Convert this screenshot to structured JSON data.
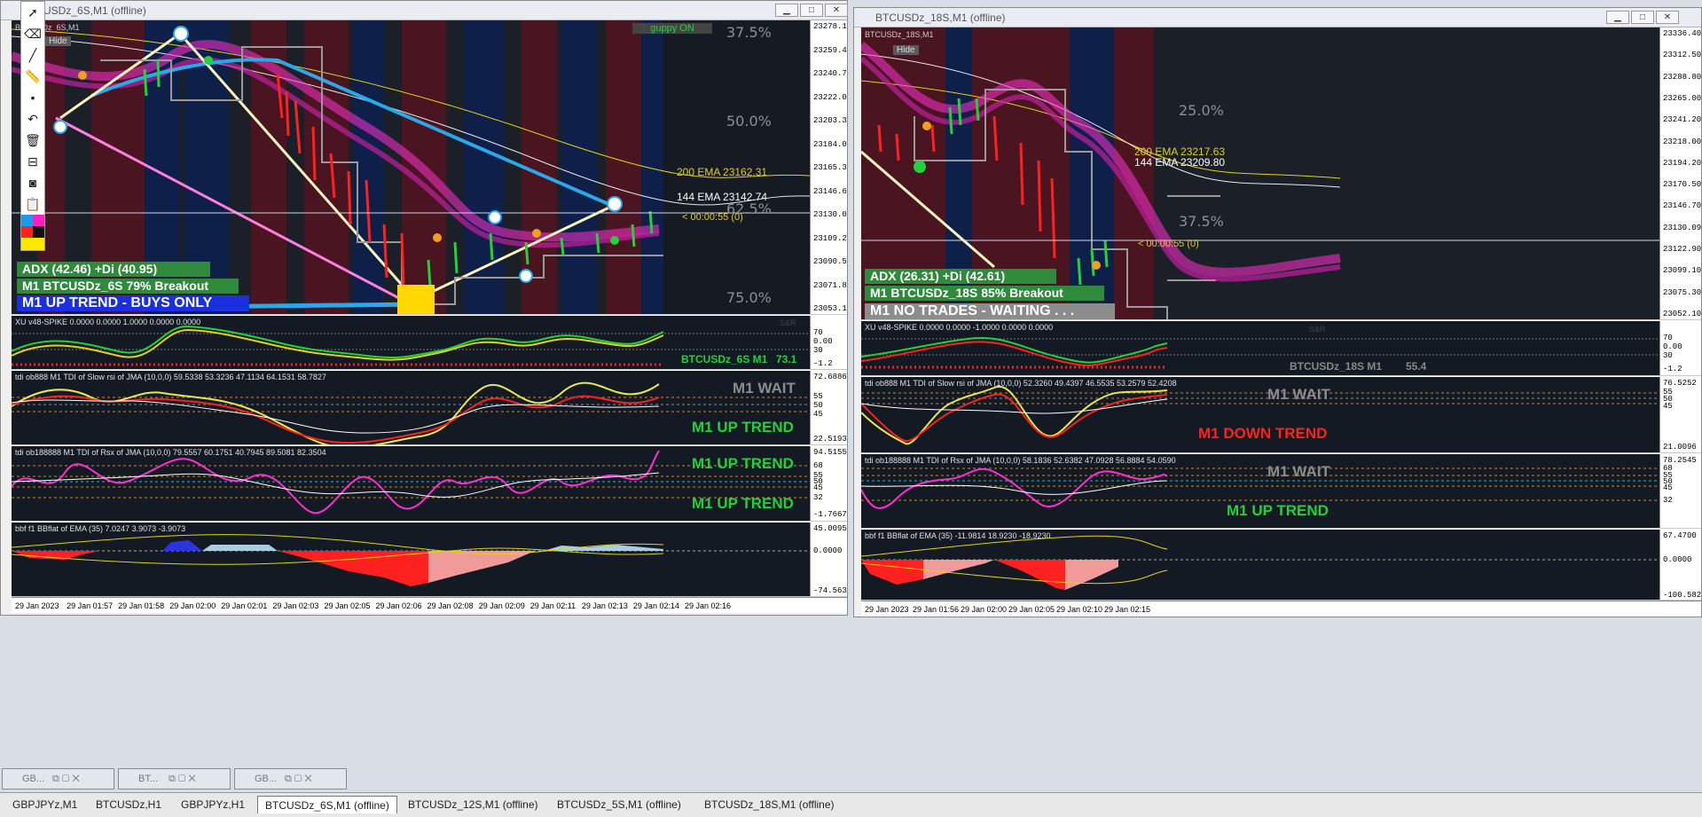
{
  "left_window": {
    "title": "BTCUSDz_6S,M1 (offline)",
    "chart_label": "BTCUSDz_6S,M1",
    "hide_button": "Hide",
    "guppy_button": "guppy ON",
    "price_axis": [
      "23278.10",
      "23259.40",
      "23240.70",
      "23222.00",
      "23203.30",
      "23184.05",
      "23165.35",
      "23146.65",
      "23130.09",
      "23109.25",
      "23090.55",
      "23071.85",
      "23053.15"
    ],
    "fib": [
      "37.5%",
      "50.0%",
      "62.5%",
      "75.0%"
    ],
    "ema200": "200 EMA 23162.31",
    "ema144": "144 EMA 23142.74",
    "countdown": "< 00:00:55 (0)",
    "adx": "ADX (42.46)  +Di (40.95)",
    "breakout": "M1 BTCUSDz_6S 79% Breakout",
    "trend_banner": "M1 UP TREND - BUYS ONLY",
    "spike_title": "XU v48-SPIKE 0.0000 0.0000 1.0000 0.0000 0.0000",
    "spike_axis": [
      "70",
      "0.00",
      "30",
      "-1.2"
    ],
    "spike_label": "BTCUSDz_6S M1",
    "spike_value": "73.1",
    "sr_label": "S&R",
    "tdi1_title": "tdi ob888 M1 TDI of Slow rsi of JMA (10,0,0) 59.5338 53.3236 47.1134 64.1531 58.7827",
    "tdi1_axis": [
      "72.6886",
      "55",
      "50",
      "45",
      "22.5193"
    ],
    "tdi1_status": "M1 WAIT",
    "tdi1_trend": "M1 UP TREND",
    "tdi2_title": "tdi ob188888 M1 TDI of Rsx of JMA (10,0,0) 79.5557 60.1751 40.7945 89.5081 82.3504",
    "tdi2_axis": [
      "94.5155",
      "68",
      "55",
      "50",
      "45",
      "32",
      "-1.7667"
    ],
    "tdi2_trend_top": "M1 UP TREND",
    "tdi2_trend_bottom": "M1 UP TREND",
    "bbf_title": "bbf f1 BBflat of EMA (35) 7.0247 3.9073 -3.9073",
    "bbf_axis": [
      "45.0095",
      "0.0000",
      "-74.5633"
    ],
    "time_axis": [
      "29 Jan 2023",
      "29 Jan 01:57",
      "29 Jan 01:58",
      "29 Jan 02:00",
      "29 Jan 02:01",
      "29 Jan 02:03",
      "29 Jan 02:05",
      "29 Jan 02:06",
      "29 Jan 02:08",
      "29 Jan 02:09",
      "29 Jan 02:11",
      "29 Jan 02:13",
      "29 Jan 02:14",
      "29 Jan 02:16"
    ]
  },
  "right_window": {
    "title": "BTCUSDz_18S,M1 (offline)",
    "chart_label": "BTCUSDz_18S,M1",
    "hide_button": "Hide",
    "price_axis": [
      "23336.40",
      "23312.50",
      "23288.80",
      "23265.00",
      "23241.20",
      "23218.00",
      "23194.20",
      "23170.50",
      "23146.70",
      "23130.09",
      "23122.90",
      "23099.10",
      "23075.30",
      "23052.10"
    ],
    "fib": [
      "25.0%",
      "37.5%"
    ],
    "ema200": "200 EMA 23217.63",
    "ema144": "144 EMA 23209.80",
    "countdown": "< 00:00:55 (0)",
    "adx": "ADX (26.31)  +Di (42.61)",
    "breakout": "M1 BTCUSDz_18S 85% Breakout",
    "trend_banner": "M1  NO TRADES - WAITING . . .",
    "spike_title": "XU v48-SPIKE 0.0000 0.0000 -1.0000 0.0000 0.0000",
    "spike_axis": [
      "70",
      "0.00",
      "30",
      "-1.2"
    ],
    "spike_label": "BTCUSDz_18S M1",
    "spike_value": "55.4",
    "sr_label": "S&R",
    "tdi1_title": "tdi ob888 M1 TDI of Slow rsi of JMA (10,0,0) 52.3260 49.4397 46.5535 53.2579 52.4208",
    "tdi1_axis": [
      "76.5252",
      "55",
      "50",
      "45",
      "21.0096"
    ],
    "tdi1_status": "M1 WAIT",
    "tdi1_trend": "M1 DOWN TREND",
    "tdi2_title": "tdi ob188888 M1 TDI of Rsx of JMA (10,0,0) 58.1836 52.6382 47.0928 56.8884 54.0590",
    "tdi2_axis": [
      "78.2545",
      "68",
      "55",
      "50",
      "45",
      "32"
    ],
    "tdi2_status": "M1 WAIT",
    "tdi2_trend": "M1 UP TREND",
    "bbf_title": "bbf f1 BBflat of EMA (35) -11.9814 18.9230 -18.9230",
    "bbf_axis": [
      "67.4700",
      "0.0000",
      "-100.5823"
    ],
    "time_axis": [
      "29 Jan 2023",
      "29 Jan 01:56",
      "29 Jan 02:00",
      "29 Jan 02:05",
      "29 Jan 02:10",
      "29 Jan 02:15"
    ]
  },
  "minimized": [
    "GB...",
    "BT...",
    "GB..."
  ],
  "tabs": [
    "GBPJPYz,M1",
    "BTCUSDz,H1",
    "GBPJPYz,H1",
    "BTCUSDz_6S,M1 (offline)",
    "BTCUSDz_12S,M1 (offline)",
    "BTCUSDz_5S,M1 (offline)",
    "BTCUSDz_18S,M1 (offline)"
  ],
  "active_tab_index": 3,
  "colors": {
    "up": "#22d23a",
    "down": "#ff2020",
    "wait": "#8c8c8c",
    "magenta": "#ff30d0",
    "cyan": "#2aa8e8",
    "ema_yellow": "#e2d21a",
    "adx_green": "#2f8a3c"
  }
}
